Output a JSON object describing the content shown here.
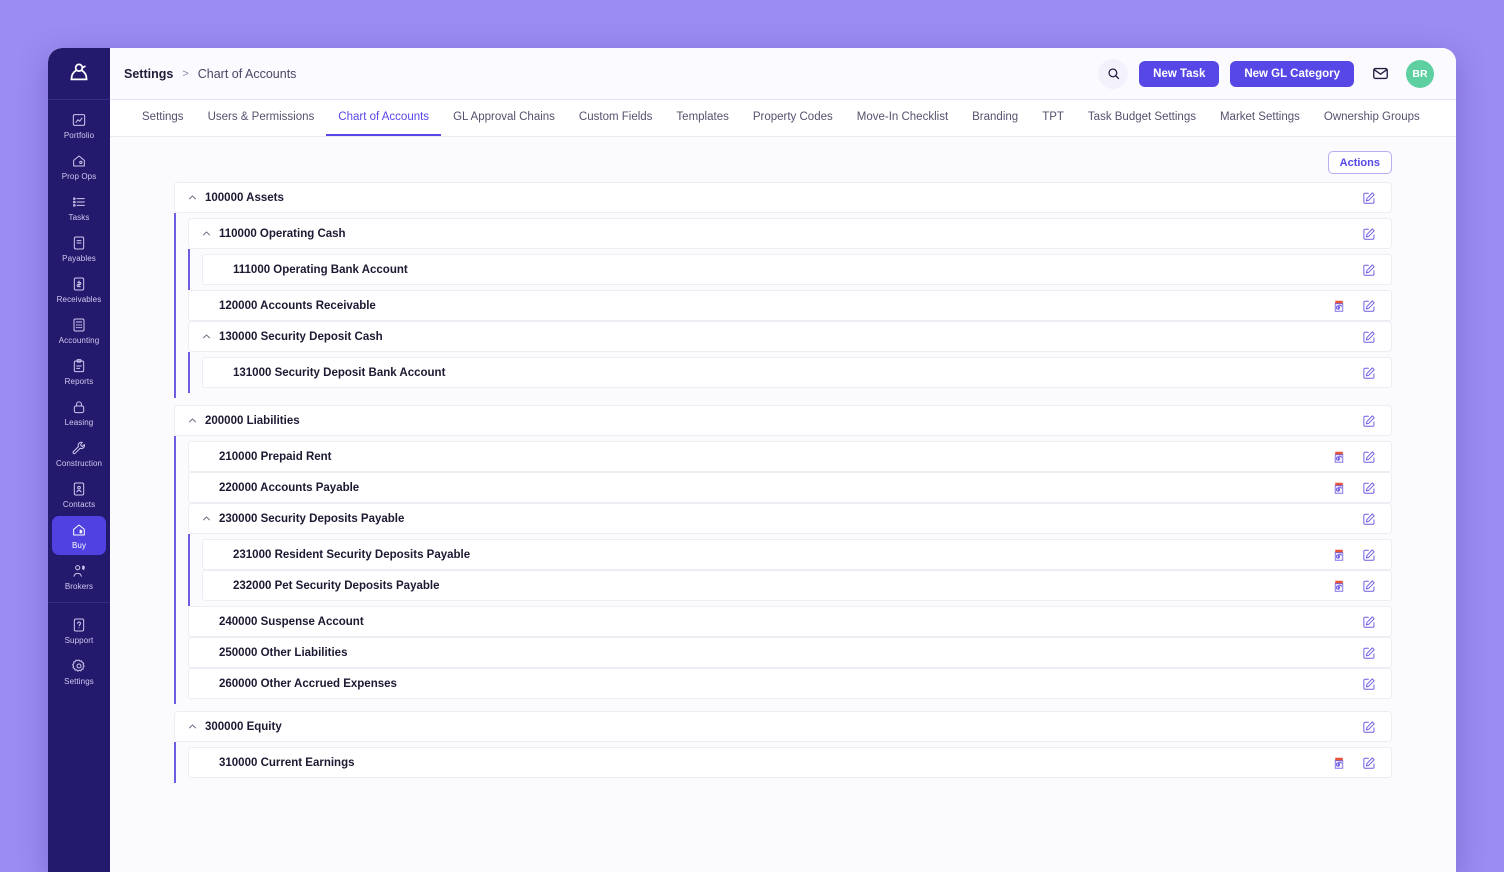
{
  "sidebar": {
    "logo": "company-logo",
    "items": [
      {
        "label": "Portfolio",
        "icon": "portfolio-icon",
        "active": false
      },
      {
        "label": "Prop Ops",
        "icon": "house-gear-icon",
        "active": false
      },
      {
        "label": "Tasks",
        "icon": "list-icon",
        "active": false
      },
      {
        "label": "Payables",
        "icon": "payables-icon",
        "active": false
      },
      {
        "label": "Receivables",
        "icon": "receivables-icon",
        "active": false
      },
      {
        "label": "Accounting",
        "icon": "calculator-icon",
        "active": false
      },
      {
        "label": "Reports",
        "icon": "clipboard-icon",
        "active": false
      },
      {
        "label": "Leasing",
        "icon": "lock-icon",
        "active": false
      },
      {
        "label": "Construction",
        "icon": "wrench-icon",
        "active": false
      },
      {
        "label": "Contacts",
        "icon": "contacts-icon",
        "active": false
      },
      {
        "label": "Buy",
        "icon": "house-dollar-icon",
        "active": true
      },
      {
        "label": "Brokers",
        "icon": "person-dollar-icon",
        "active": false
      }
    ],
    "bottom_items": [
      {
        "label": "Support",
        "icon": "support-icon"
      },
      {
        "label": "Settings",
        "icon": "gear-icon"
      }
    ]
  },
  "topbar": {
    "breadcrumb_root": "Settings",
    "breadcrumb_separator": ">",
    "breadcrumb_current": "Chart of Accounts",
    "search_icon": "search-icon",
    "new_task_label": "New Task",
    "new_gl_category_label": "New GL Category",
    "mail_icon": "mail-icon",
    "avatar_initials": "BR",
    "avatar_color": "#5ecfa0",
    "accent_color": "#5647e6"
  },
  "tabs": [
    {
      "label": "Settings",
      "active": false
    },
    {
      "label": "Users & Permissions",
      "active": false
    },
    {
      "label": "Chart of Accounts",
      "active": true
    },
    {
      "label": "GL Approval Chains",
      "active": false
    },
    {
      "label": "Custom Fields",
      "active": false
    },
    {
      "label": "Templates",
      "active": false
    },
    {
      "label": "Property Codes",
      "active": false
    },
    {
      "label": "Move-In Checklist",
      "active": false
    },
    {
      "label": "Branding",
      "active": false
    },
    {
      "label": "TPT",
      "active": false
    },
    {
      "label": "Task Budget Settings",
      "active": false
    },
    {
      "label": "Market Settings",
      "active": false
    },
    {
      "label": "Ownership Groups",
      "active": false
    }
  ],
  "toolbar": {
    "actions_label": "Actions"
  },
  "tree": [
    {
      "title": "100000 Assets",
      "expandable": true,
      "expanded": true,
      "locked": false,
      "children": [
        {
          "title": "110000 Operating Cash",
          "expandable": true,
          "expanded": true,
          "locked": false,
          "children": [
            {
              "title": "111000 Operating Bank Account",
              "expandable": false,
              "locked": false,
              "children": []
            }
          ]
        },
        {
          "title": "120000 Accounts Receivable",
          "expandable": false,
          "locked": true,
          "children": []
        },
        {
          "title": "130000 Security Deposit Cash",
          "expandable": true,
          "expanded": true,
          "locked": false,
          "children": [
            {
              "title": "131000 Security Deposit Bank Account",
              "expandable": false,
              "locked": false,
              "children": []
            }
          ]
        }
      ]
    },
    {
      "title": "200000 Liabilities",
      "expandable": true,
      "expanded": true,
      "locked": false,
      "children": [
        {
          "title": "210000 Prepaid Rent",
          "expandable": false,
          "locked": true,
          "children": []
        },
        {
          "title": "220000 Accounts Payable",
          "expandable": false,
          "locked": true,
          "children": []
        },
        {
          "title": "230000 Security Deposits Payable",
          "expandable": true,
          "expanded": true,
          "locked": false,
          "children": [
            {
              "title": "231000 Resident Security Deposits Payable",
              "expandable": false,
              "locked": true,
              "children": []
            },
            {
              "title": "232000 Pet Security Deposits Payable",
              "expandable": false,
              "locked": true,
              "children": []
            }
          ]
        },
        {
          "title": "240000 Suspense Account",
          "expandable": false,
          "locked": false,
          "children": []
        },
        {
          "title": "250000 Other Liabilities",
          "expandable": false,
          "locked": false,
          "children": []
        },
        {
          "title": "260000 Other Accrued Expenses",
          "expandable": false,
          "locked": false,
          "children": []
        }
      ]
    },
    {
      "title": "300000 Equity",
      "expandable": true,
      "expanded": true,
      "locked": false,
      "children": [
        {
          "title": "310000 Current Earnings",
          "expandable": false,
          "locked": true,
          "children": []
        }
      ]
    }
  ],
  "icons": {
    "edit": "edit-icon",
    "locked": "locked-account-icon",
    "chevron_up": "chevron-up-icon"
  }
}
